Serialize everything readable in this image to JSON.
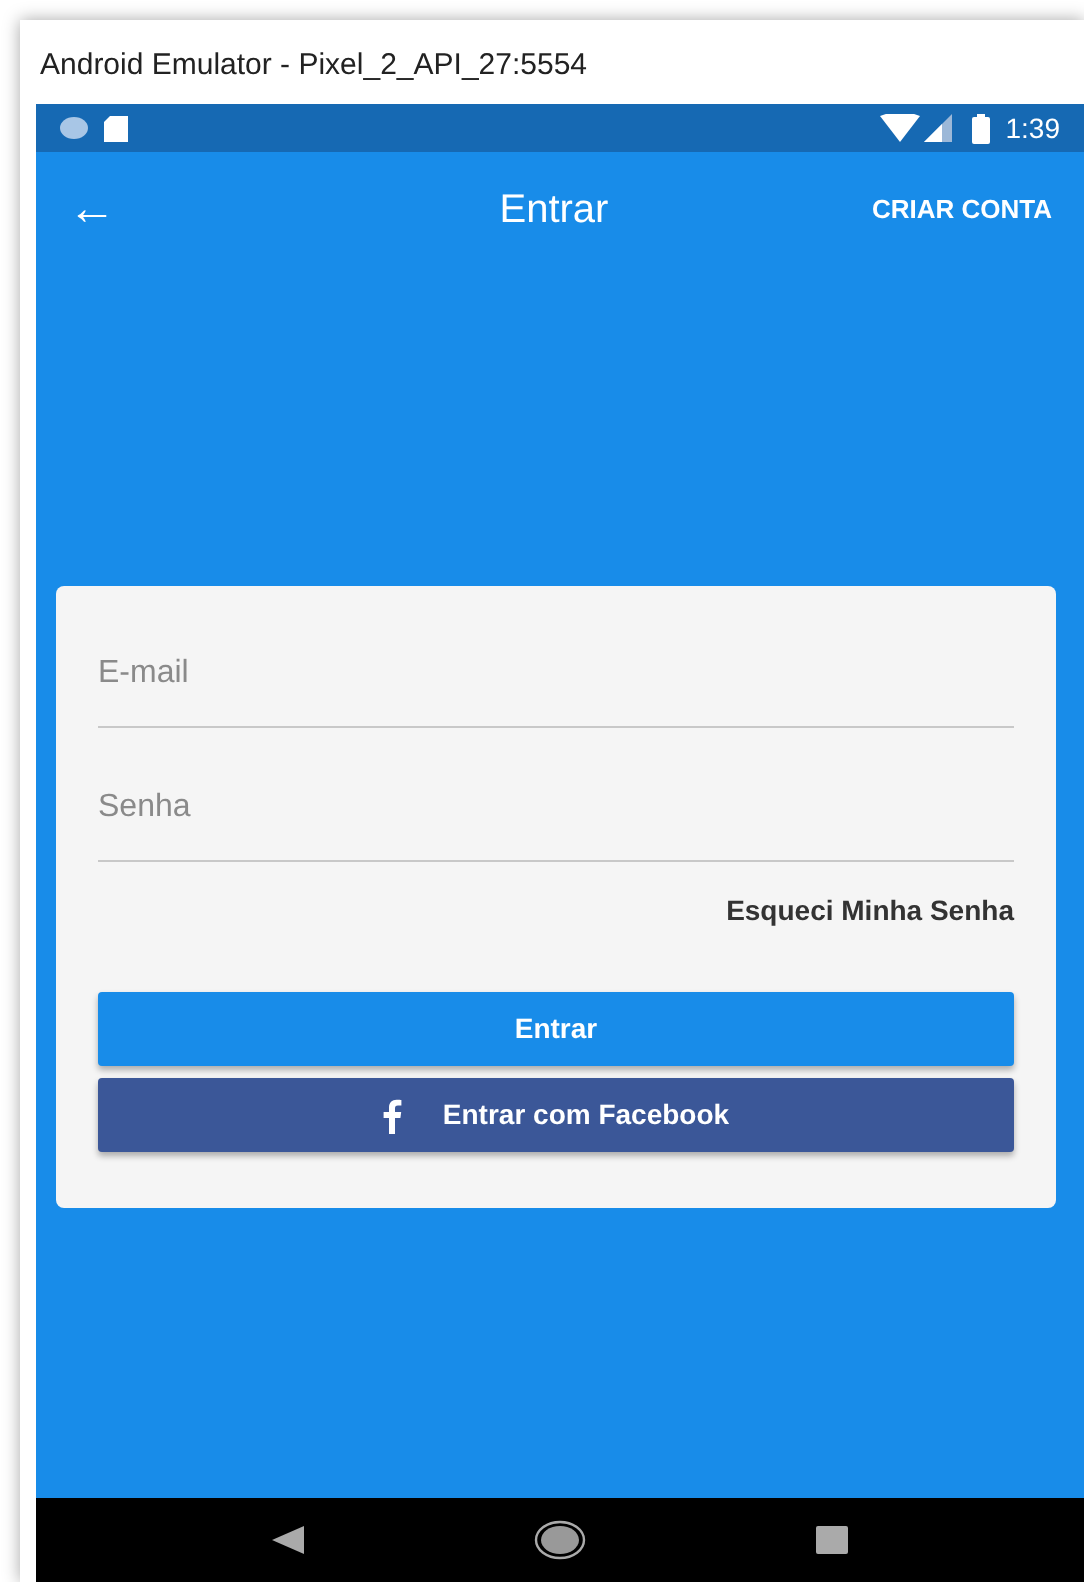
{
  "window": {
    "title": "Android Emulator - Pixel_2_API_27:5554"
  },
  "status_bar": {
    "time": "1:39"
  },
  "app_bar": {
    "back_glyph": "←",
    "title": "Entrar",
    "action": "CRIAR CONTA"
  },
  "form": {
    "fields": [
      {
        "placeholder": "E-mail"
      },
      {
        "placeholder": "Senha"
      }
    ],
    "forgot_link": "Esqueci Minha Senha",
    "buttons": [
      {
        "label": "Entrar",
        "kind": "primary"
      },
      {
        "label": "Entrar com Facebook",
        "kind": "facebook"
      }
    ]
  }
}
